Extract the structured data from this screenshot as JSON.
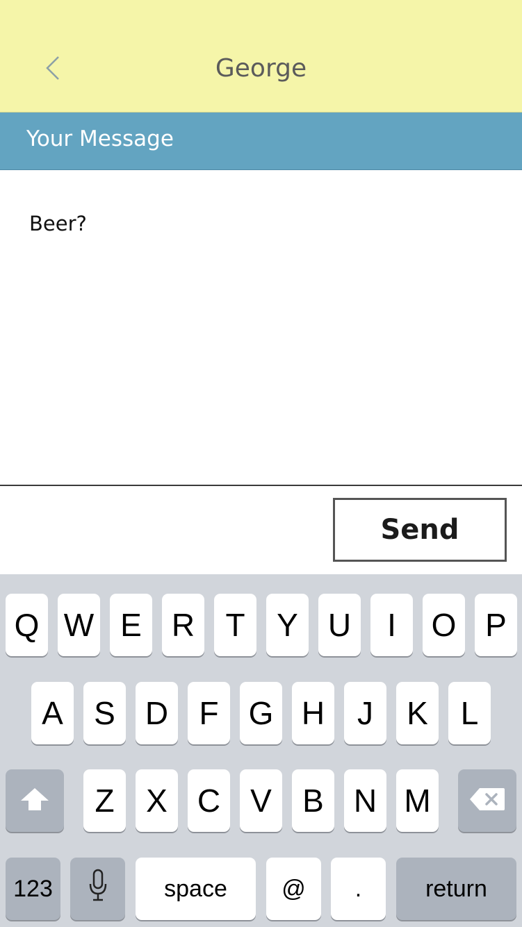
{
  "header": {
    "title": "George",
    "back_icon": "chevron-left-icon"
  },
  "section": {
    "label": "Your Message"
  },
  "message": {
    "text": "Beer?"
  },
  "actions": {
    "send_label": "Send"
  },
  "keyboard": {
    "row1": [
      "Q",
      "W",
      "E",
      "R",
      "T",
      "Y",
      "U",
      "I",
      "O",
      "P"
    ],
    "row2": [
      "A",
      "S",
      "D",
      "F",
      "G",
      "H",
      "J",
      "K",
      "L"
    ],
    "row3": [
      "Z",
      "X",
      "C",
      "V",
      "B",
      "N",
      "M"
    ],
    "shift_icon": "shift-arrow-icon",
    "backspace_icon": "backspace-icon",
    "numbers_label": "123",
    "mic_icon": "microphone-icon",
    "space_label": "space",
    "at_label": "@",
    "period_label": ".",
    "return_label": "return"
  },
  "colors": {
    "header_bg": "#f5f5a9",
    "section_bg": "#63a4c1",
    "keyboard_bg": "#d1d5db",
    "key_bg": "#ffffff",
    "fn_key_bg": "#acb3bd"
  }
}
